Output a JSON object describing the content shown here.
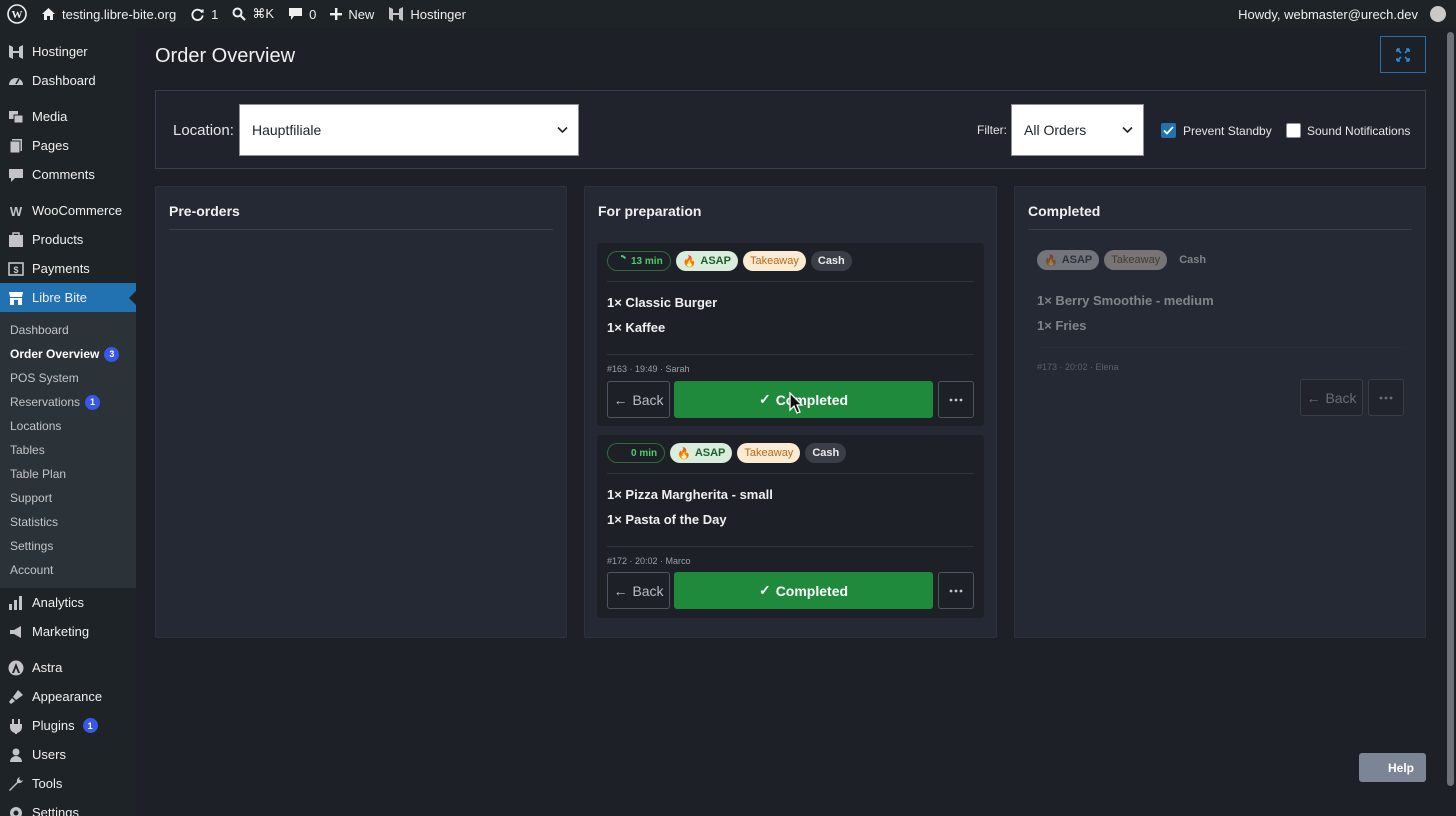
{
  "adminbar": {
    "site_name": "testing.libre-bite.org",
    "updates_count": "1",
    "search_shortcut": "⌘K",
    "comments_count": "0",
    "new_label": "New",
    "hosting_label": "Hostinger",
    "howdy": "Howdy, webmaster@urech.dev"
  },
  "sidebar": {
    "top_items": [
      {
        "label": "Hostinger",
        "icon": "hostinger-icon"
      },
      {
        "label": "Dashboard",
        "icon": "dashboard-icon"
      },
      {
        "label": "Media",
        "icon": "media-icon"
      },
      {
        "label": "Pages",
        "icon": "pages-icon"
      },
      {
        "label": "Comments",
        "icon": "comments-icon"
      },
      {
        "label": "WooCommerce",
        "icon": "woocommerce-icon"
      },
      {
        "label": "Products",
        "icon": "products-icon"
      },
      {
        "label": "Payments",
        "icon": "payments-icon"
      },
      {
        "label": "Libre Bite",
        "icon": "store-icon"
      }
    ],
    "submenu": [
      {
        "label": "Dashboard",
        "badge": ""
      },
      {
        "label": "Order Overview",
        "badge": "3"
      },
      {
        "label": "POS System",
        "badge": ""
      },
      {
        "label": "Reservations",
        "badge": "1"
      },
      {
        "label": "Locations",
        "badge": ""
      },
      {
        "label": "Tables",
        "badge": ""
      },
      {
        "label": "Table Plan",
        "badge": ""
      },
      {
        "label": "Support",
        "badge": ""
      },
      {
        "label": "Statistics",
        "badge": ""
      },
      {
        "label": "Settings",
        "badge": ""
      },
      {
        "label": "Account",
        "badge": ""
      }
    ],
    "bottom_items": [
      {
        "label": "Analytics",
        "icon": "analytics-icon",
        "badge": ""
      },
      {
        "label": "Marketing",
        "icon": "marketing-icon",
        "badge": ""
      },
      {
        "label": "Astra",
        "icon": "astra-icon",
        "badge": ""
      },
      {
        "label": "Appearance",
        "icon": "appearance-icon",
        "badge": ""
      },
      {
        "label": "Plugins",
        "icon": "plugins-icon",
        "badge": "1"
      },
      {
        "label": "Users",
        "icon": "users-icon",
        "badge": ""
      },
      {
        "label": "Tools",
        "icon": "tools-icon",
        "badge": ""
      },
      {
        "label": "Settings",
        "icon": "settings-icon",
        "badge": ""
      }
    ]
  },
  "page": {
    "title": "Order Overview"
  },
  "filters": {
    "location_label": "Location:",
    "location_value": "Hauptfiliale",
    "filter_label": "Filter:",
    "filter_value": "All Orders",
    "prevent_standby_label": "Prevent Standby",
    "prevent_standby_checked": true,
    "sound_notifications_label": "Sound Notifications",
    "sound_notifications_checked": false
  },
  "columns": {
    "preorders": {
      "title": "Pre-orders"
    },
    "preparation": {
      "title": "For preparation",
      "orders": [
        {
          "timer": "13 min",
          "asap": "ASAP",
          "takeaway": "Takeaway",
          "payment": "Cash",
          "items": [
            "1× Classic Burger",
            "1× Kaffee"
          ],
          "meta": "#163 · 19:49 · Sarah",
          "back_label": "Back",
          "complete_label": "Completed"
        },
        {
          "timer": "0 min",
          "asap": "ASAP",
          "takeaway": "Takeaway",
          "payment": "Cash",
          "items": [
            "1× Pizza Margherita - small",
            "1× Pasta of the Day"
          ],
          "meta": "#172 · 20:02 · Marco",
          "back_label": "Back",
          "complete_label": "Completed"
        }
      ]
    },
    "completed": {
      "title": "Completed",
      "orders": [
        {
          "asap": "ASAP",
          "takeaway": "Takeaway",
          "payment": "Cash",
          "items": [
            "1× Berry Smoothie - medium",
            "1× Fries"
          ],
          "meta": "#173 · 20:02 · Elena",
          "back_label": "Back"
        }
      ]
    }
  },
  "help_label": "Help",
  "colors": {
    "accent": "#2271b1",
    "complete_green": "#1f8a3c",
    "badge_blue": "#3858e9"
  }
}
